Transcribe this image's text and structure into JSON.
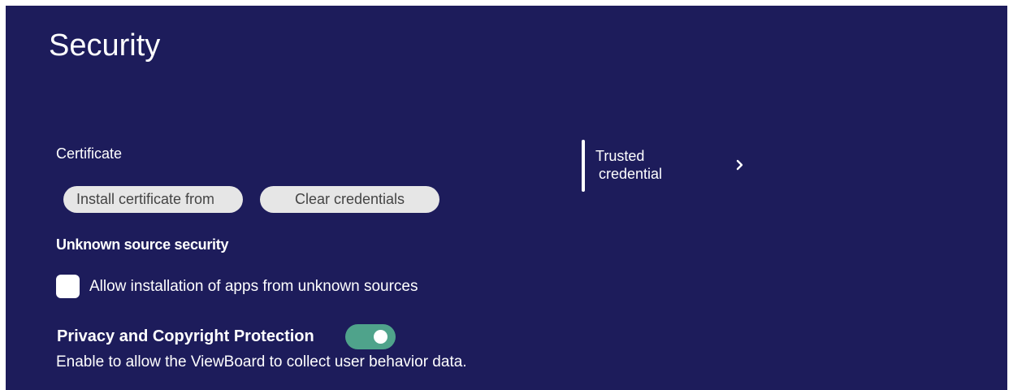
{
  "header": {
    "title": "Security"
  },
  "certificate": {
    "label": "Certificate",
    "install_button": "Install certificate from",
    "clear_button": "Clear credentials"
  },
  "trusted_credential": {
    "line1": "Trusted",
    "line2": "credential",
    "icon": "chevron-right-icon"
  },
  "unknown_source": {
    "heading": "Unknown source security",
    "checkbox_label": "Allow installation of apps from unknown sources",
    "checked": false
  },
  "privacy": {
    "title": "Privacy and Copyright Protection",
    "toggle_on": true,
    "description": "Enable to allow the ViewBoard to collect user behavior data."
  },
  "colors": {
    "background": "#1d1c5b",
    "toggle_on": "#4fa38b",
    "pill_button": "#e6e6e6"
  }
}
